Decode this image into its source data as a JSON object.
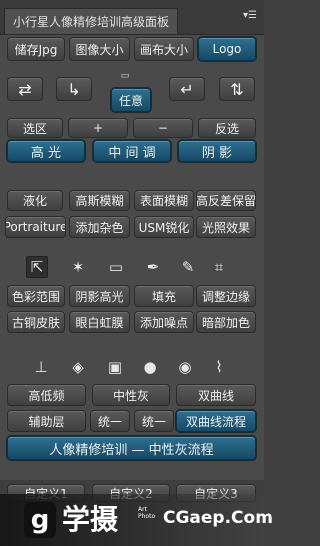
{
  "title": "小行星人像精修培训高级面板",
  "menu_icon": "panel-menu-icon",
  "row1": [
    "储存Jpg",
    "图像大小",
    "画布大小",
    "Logo"
  ],
  "row3_center": "任意",
  "row4": [
    "选区",
    "+",
    "−",
    "反选"
  ],
  "row5": [
    "高 光",
    "中 间 调",
    "阴 影"
  ],
  "row6": [
    "液化",
    "高斯模糊",
    "表面模糊",
    "高反差保留"
  ],
  "row7": [
    "Portraiture",
    "添加杂色",
    "USM锐化",
    "光照效果"
  ],
  "row9": [
    "色彩范围",
    "阴影高光",
    "填充",
    "调整边缘"
  ],
  "row10": [
    "古铜皮肤",
    "眼白虹膜",
    "添加噪点",
    "暗部加色"
  ],
  "row12": [
    "高低频",
    "中性灰",
    "双曲线"
  ],
  "row13": [
    "辅助层",
    "统一",
    "统一",
    "双曲线流程"
  ],
  "row14": "人像精修培训 — 中性灰流程",
  "row15": [
    "自定义1",
    "自定义2",
    "自定义3"
  ],
  "watermark": {
    "logo_char": "g",
    "text": "学摄",
    "small": "Art Photo",
    "url": "CGaep.Com"
  }
}
